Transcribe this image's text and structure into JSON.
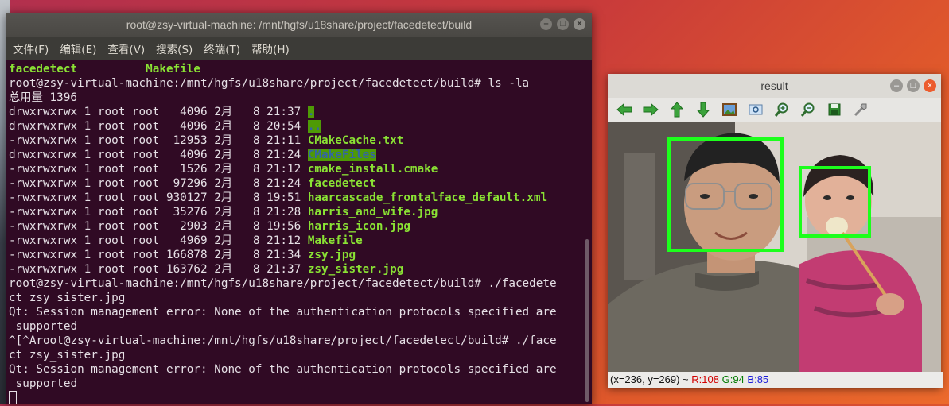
{
  "terminal": {
    "title": "root@zsy-virtual-machine: /mnt/hgfs/u18share/project/facedetect/build",
    "menu": [
      "文件(F)",
      "编辑(E)",
      "查看(V)",
      "搜索(S)",
      "终端(T)",
      "帮助(H)"
    ],
    "lines": [
      {
        "segments": [
          {
            "t": "facedetect",
            "c": "g"
          },
          {
            "t": "          "
          },
          {
            "t": "Makefile",
            "c": "g"
          }
        ]
      },
      {
        "segments": [
          {
            "t": "root@zsy-virtual-machine:/mnt/hgfs/u18share/project/facedetect/build# ls -la"
          }
        ]
      },
      {
        "segments": [
          {
            "t": "总用量 1396"
          }
        ]
      },
      {
        "segments": [
          {
            "t": "drwxrwxrwx 1 root root   4096 2月   8 21:37 "
          },
          {
            "t": ".",
            "c": "hl"
          }
        ]
      },
      {
        "segments": [
          {
            "t": "drwxrwxrwx 1 root root   4096 2月   8 20:54 "
          },
          {
            "t": "..",
            "c": "hl"
          }
        ]
      },
      {
        "segments": [
          {
            "t": "-rwxrwxrwx 1 root root  12953 2月   8 21:11 "
          },
          {
            "t": "CMakeCache.txt",
            "c": "g"
          }
        ]
      },
      {
        "segments": [
          {
            "t": "drwxrwxrwx 1 root root   4096 2月   8 21:24 "
          },
          {
            "t": "CMakeFiles",
            "c": "hl"
          }
        ]
      },
      {
        "segments": [
          {
            "t": "-rwxrwxrwx 1 root root   1526 2月   8 21:12 "
          },
          {
            "t": "cmake_install.cmake",
            "c": "g"
          }
        ]
      },
      {
        "segments": [
          {
            "t": "-rwxrwxrwx 1 root root  97296 2月   8 21:24 "
          },
          {
            "t": "facedetect",
            "c": "g"
          }
        ]
      },
      {
        "segments": [
          {
            "t": "-rwxrwxrwx 1 root root 930127 2月   8 19:51 "
          },
          {
            "t": "haarcascade_frontalface_default.xml",
            "c": "g"
          }
        ]
      },
      {
        "segments": [
          {
            "t": "-rwxrwxrwx 1 root root  35276 2月   8 21:28 "
          },
          {
            "t": "harris_and_wife.jpg",
            "c": "g"
          }
        ]
      },
      {
        "segments": [
          {
            "t": "-rwxrwxrwx 1 root root   2903 2月   8 19:56 "
          },
          {
            "t": "harris_icon.jpg",
            "c": "g"
          }
        ]
      },
      {
        "segments": [
          {
            "t": "-rwxrwxrwx 1 root root   4969 2月   8 21:12 "
          },
          {
            "t": "Makefile",
            "c": "g"
          }
        ]
      },
      {
        "segments": [
          {
            "t": "-rwxrwxrwx 1 root root 166878 2月   8 21:34 "
          },
          {
            "t": "zsy.jpg",
            "c": "g"
          }
        ]
      },
      {
        "segments": [
          {
            "t": "-rwxrwxrwx 1 root root 163762 2月   8 21:37 "
          },
          {
            "t": "zsy_sister.jpg",
            "c": "g"
          }
        ]
      },
      {
        "segments": [
          {
            "t": "root@zsy-virtual-machine:/mnt/hgfs/u18share/project/facedetect/build# ./facedete"
          }
        ]
      },
      {
        "segments": [
          {
            "t": "ct zsy_sister.jpg"
          }
        ]
      },
      {
        "segments": [
          {
            "t": "Qt: Session management error: None of the authentication protocols specified are"
          }
        ]
      },
      {
        "segments": [
          {
            "t": " supported"
          }
        ]
      },
      {
        "segments": [
          {
            "t": "^[^Aroot@zsy-virtual-machine:/mnt/hgfs/u18share/project/facedetect/build# ./face"
          }
        ]
      },
      {
        "segments": [
          {
            "t": "ct zsy_sister.jpg"
          }
        ]
      },
      {
        "segments": [
          {
            "t": "Qt: Session management error: None of the authentication protocols specified are"
          }
        ]
      },
      {
        "segments": [
          {
            "t": " supported"
          }
        ]
      }
    ]
  },
  "result": {
    "title": "result",
    "toolbar": [
      "arrow-left-icon",
      "arrow-right-icon",
      "arrow-up-icon",
      "arrow-down-icon",
      "image-icon",
      "fit-icon",
      "zoom-in-icon",
      "zoom-out-icon",
      "save-icon",
      "properties-icon"
    ],
    "status": {
      "coords": "(x=236, y=269) ~ ",
      "r": "R:108",
      "g": "G:94",
      "b": "B:85"
    }
  }
}
